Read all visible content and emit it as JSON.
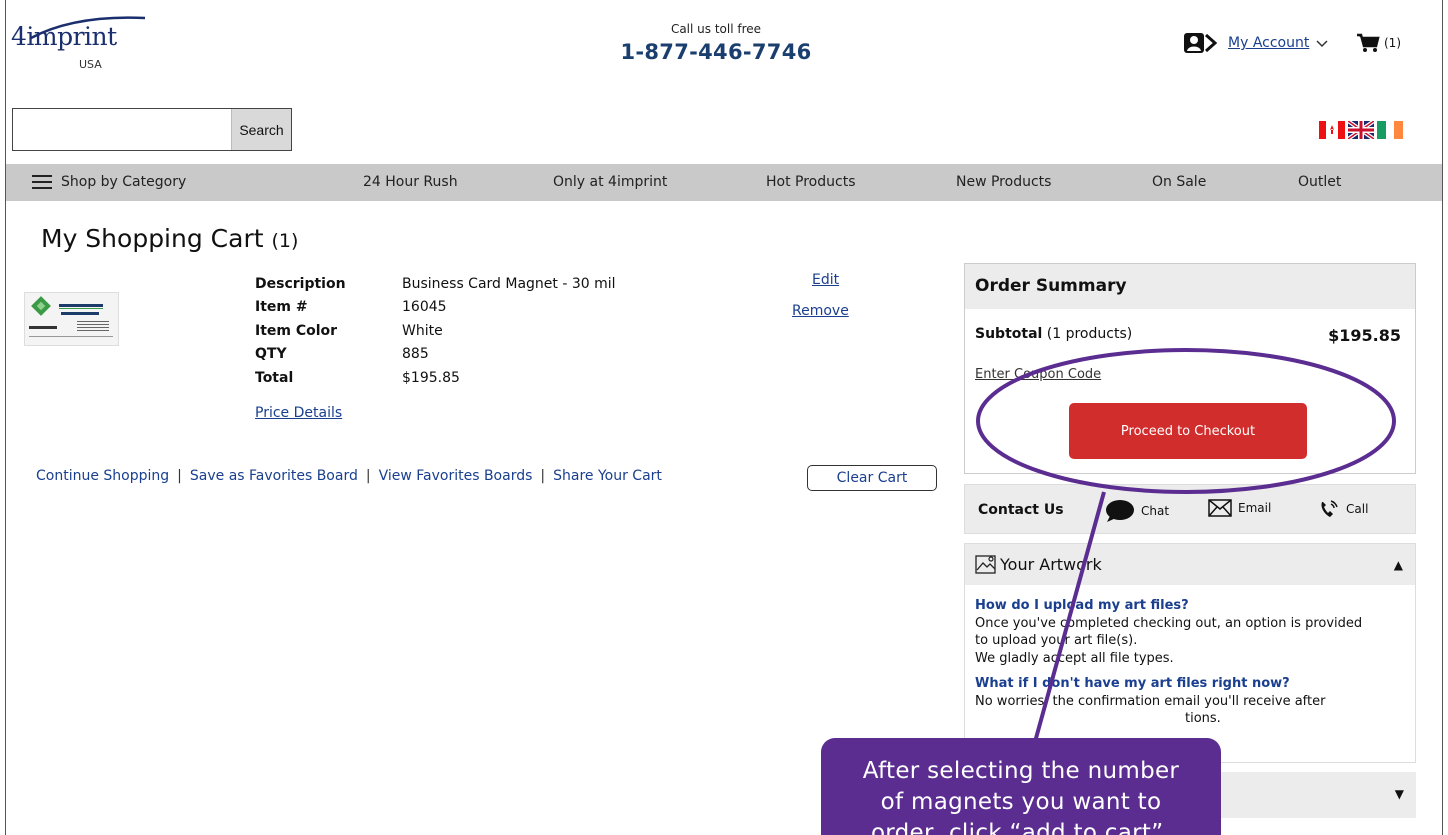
{
  "header": {
    "logo_text": "4imprint",
    "logo_sub": "USA",
    "phone_caption": "Call us toll free",
    "phone_number": "1-877-446-7746",
    "account_label": "My Account",
    "cart_count": "(1)"
  },
  "search": {
    "placeholder": "",
    "button_label": "Search"
  },
  "flags": [
    "canada-flag",
    "uk-flag",
    "ireland-flag"
  ],
  "nav": {
    "items": [
      {
        "label": "Shop by Category"
      },
      {
        "label": "24 Hour Rush"
      },
      {
        "label": "Only at 4imprint"
      },
      {
        "label": "Hot Products"
      },
      {
        "label": "New Products"
      },
      {
        "label": "On Sale"
      },
      {
        "label": "Outlet"
      }
    ]
  },
  "cart": {
    "title": "My Shopping Cart",
    "count": "(1)",
    "item": {
      "thumbnail_company": "Monticessor Real Estate",
      "thumbnail_name": "Josie Walden",
      "rows": [
        {
          "label": "Description",
          "value": "Business Card Magnet - 30 mil"
        },
        {
          "label": "Item #",
          "value": "16045"
        },
        {
          "label": "Item Color",
          "value": "White"
        },
        {
          "label": "QTY",
          "value": "885"
        },
        {
          "label": "Total",
          "value": "$195.85"
        }
      ],
      "price_details_link": "Price Details",
      "edit_link": "Edit",
      "remove_link": "Remove"
    },
    "links": [
      "Continue Shopping",
      "Save as Favorites Board",
      "View Favorites Boards",
      "Share Your Cart"
    ],
    "separator": "|",
    "clear_cart": "Clear Cart"
  },
  "summary": {
    "title": "Order Summary",
    "subtotal_label": "Subtotal",
    "subtotal_count": "(1 products)",
    "subtotal_value": "$195.85",
    "coupon_link": "Enter Coupon Code",
    "checkout_button": "Proceed to Checkout"
  },
  "contact": {
    "title": "Contact Us",
    "chat": "Chat",
    "email": "Email",
    "call": "Call"
  },
  "artwork": {
    "title": "Your Artwork",
    "q1": "How do I upload my art files?",
    "a1_line1": "Once you've completed checking out, an option is provided",
    "a1_line2": "to upload your art file(s).",
    "a1_line3": "We gladly accept all file types.",
    "q2": "What if I don't have my art files right now?",
    "a2_line1": "No worries, the confirmation email you'll receive after",
    "a2_line2": "tions."
  },
  "annotation": {
    "line1": "After selecting the number",
    "line2": "of magnets you want to",
    "line3": "order, click “add to cart”.",
    "color": "#5b2d91"
  },
  "colors": {
    "checkout_red": "#d12d2d",
    "link_blue": "#1a3f8f",
    "nav_gray": "#c9c9c9"
  }
}
